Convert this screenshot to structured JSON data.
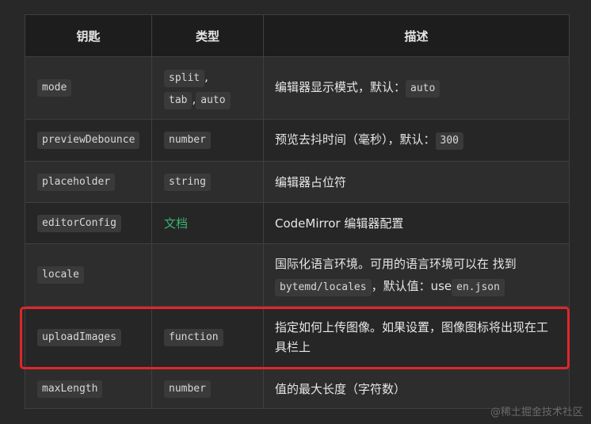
{
  "table": {
    "headers": [
      "钥匙",
      "类型",
      "描述"
    ],
    "rows": [
      {
        "key": "mode",
        "type_codes": [
          "split",
          "tab",
          "auto"
        ],
        "type_sep": ",",
        "desc_text": "编辑器显示模式，默认：",
        "desc_code": "auto"
      },
      {
        "key": "previewDebounce",
        "type_code": "number",
        "desc_text": "预览去抖时间（毫秒），默认：",
        "desc_code": "300"
      },
      {
        "key": "placeholder",
        "type_code": "string",
        "desc_text": "编辑器占位符"
      },
      {
        "key": "editorConfig",
        "type_link": "文档",
        "desc_text": "CodeMirror 编辑器配置"
      },
      {
        "key": "locale",
        "type_code": "",
        "desc_line1": "国际化语言环境。可用的语言环境可以在 找到",
        "desc_code1": "bytemd/locales",
        "desc_mid": "，默认值：use",
        "desc_code2": "en.json"
      },
      {
        "key": "uploadImages",
        "type_code": "function",
        "desc_text": "指定如何上传图像。如果设置，图像图标将出现在工具栏上"
      },
      {
        "key": "maxLength",
        "type_code": "number",
        "desc_text": "值的最大长度（字符数）"
      }
    ]
  },
  "highlight_color": "#e0262b",
  "link_color": "#3cb371",
  "watermark": "@稀土掘金技术社区"
}
